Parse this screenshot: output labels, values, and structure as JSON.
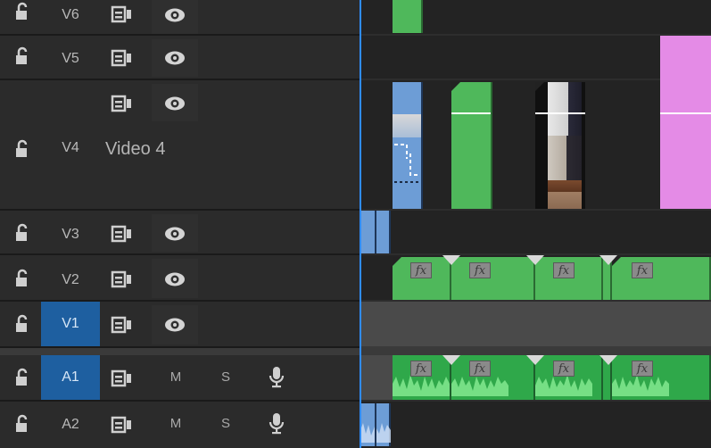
{
  "tracks": {
    "v6": {
      "label": "V6"
    },
    "v5": {
      "label": "V5"
    },
    "v4": {
      "label": "V4",
      "name": "Video 4"
    },
    "v3": {
      "label": "V3"
    },
    "v2": {
      "label": "V2"
    },
    "v1": {
      "label": "V1"
    },
    "a1": {
      "label": "A1",
      "mute": "M",
      "solo": "S"
    },
    "a2": {
      "label": "A2",
      "mute": "M",
      "solo": "S"
    }
  },
  "clips": {
    "fx_label": "fx"
  },
  "colors": {
    "target_blue": "#1e5fa0",
    "clip_green": "#4fb85b",
    "clip_pink": "#e48be6",
    "clip_blue": "#6d9dd6",
    "playhead": "#2f8cff"
  },
  "icons": [
    "lock-icon",
    "sync-lock-toggle-icon",
    "eye-icon",
    "microphone-icon",
    "fx-badge-icon",
    "transition-icon"
  ]
}
